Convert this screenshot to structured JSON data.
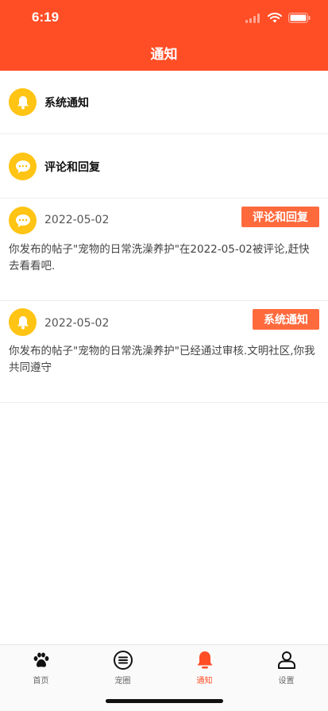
{
  "status_bar": {
    "time": "6:19"
  },
  "nav": {
    "title": "通知"
  },
  "categories": [
    {
      "label": "系统通知",
      "icon": "bell-icon"
    },
    {
      "label": "评论和回复",
      "icon": "chat-bubble-icon"
    }
  ],
  "messages": [
    {
      "date": "2022-05-02",
      "tag": "评论和回复",
      "text": "你发布的帖子\"宠物的日常洗澡养护\"在2022-05-02被评论,赶快去看看吧.",
      "icon": "chat-bubble-icon"
    },
    {
      "date": "2022-05-02",
      "tag": "系统通知",
      "text": "你发布的帖子\"宠物的日常洗澡养护\"已经通过审核.文明社区,你我共同遵守",
      "icon": "bell-icon"
    }
  ],
  "tabs": [
    {
      "label": "首页",
      "icon": "paw-icon"
    },
    {
      "label": "宠圈",
      "icon": "list-circle-icon"
    },
    {
      "label": "通知",
      "icon": "bell-icon",
      "active": true
    },
    {
      "label": "设置",
      "icon": "user-icon"
    }
  ],
  "colors": {
    "primary": "#ff4d26",
    "accent_yellow": "#ffc414",
    "tag_bg": "#ff6a3d"
  }
}
